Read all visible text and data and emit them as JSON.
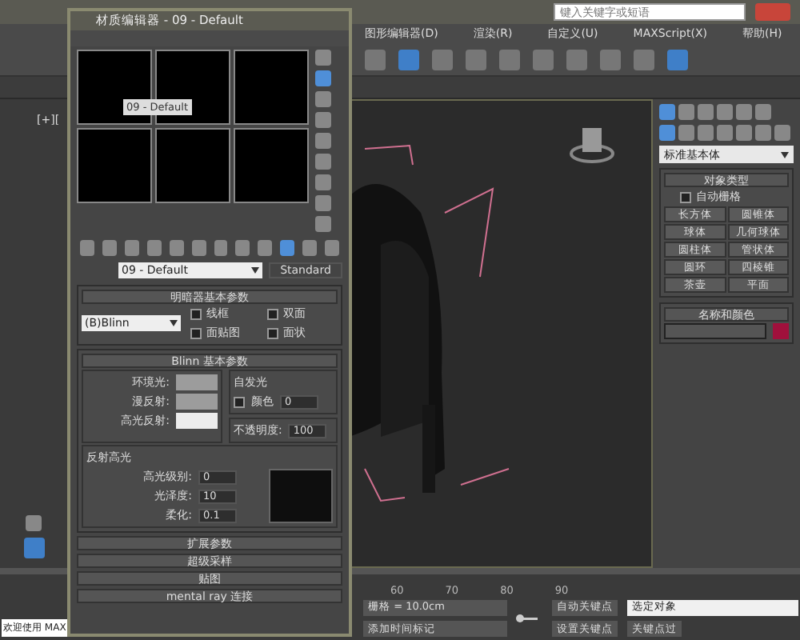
{
  "app": {
    "search_placeholder": "键入关键字或短语",
    "menu": [
      "图形编辑器(D)",
      "渲染(R)",
      "自定义(U)",
      "MAXScript(X)",
      "帮助(H)"
    ],
    "viewport_label": "[+]["
  },
  "material_editor": {
    "title": "材质编辑器 - 09 - Default",
    "tooltip": "09 - Default",
    "material_name": "09 - Default",
    "material_type": "Standard",
    "shader": {
      "title": "明暗器基本参数",
      "value": "(B)Blinn",
      "options": [
        {
          "label": "线框",
          "checked": false
        },
        {
          "label": "双面",
          "checked": false
        },
        {
          "label": "面贴图",
          "checked": false
        },
        {
          "label": "面状",
          "checked": false
        }
      ]
    },
    "blinn": {
      "title": "Blinn 基本参数",
      "colors": [
        {
          "label": "环境光:",
          "color": "#9c9c9c"
        },
        {
          "label": "漫反射:",
          "color": "#9c9c9c"
        },
        {
          "label": "高光反射:",
          "color": "#ececec"
        }
      ],
      "self_illum": {
        "title": "自发光",
        "label": "颜色",
        "checked": false,
        "value": "0"
      },
      "opacity": {
        "label": "不透明度:",
        "value": "100"
      },
      "highlights": {
        "title": "反射高光",
        "fields": [
          {
            "label": "高光级别:",
            "value": "0"
          },
          {
            "label": "光泽度:",
            "value": "10"
          },
          {
            "label": "柔化:",
            "value": "0.1"
          }
        ]
      }
    },
    "rollouts": [
      "扩展参数",
      "超级采样",
      "贴图",
      "mental ray 连接"
    ]
  },
  "command_panel": {
    "dropdown": "标准基本体",
    "object_type": "对象类型",
    "autogrid": {
      "label": "自动栅格",
      "checked": false
    },
    "buttons": [
      "长方体",
      "圆锥体",
      "球体",
      "几何球体",
      "圆柱体",
      "管状体",
      "圆环",
      "四棱锥",
      "茶壶",
      "平面"
    ],
    "name_color": "名称和颜色",
    "color": "#a0103c"
  },
  "timeline": {
    "ticks": [
      "60",
      "70",
      "80",
      "90"
    ]
  },
  "status": {
    "welcome": "欢迎使用 MAX",
    "grid": "栅格 = 10.0cm",
    "add_tag": "添加时间标记",
    "auto_key": "自动关键点",
    "selected": "选定对象",
    "set_key": "设置关键点",
    "key_filter": "关键点过"
  }
}
